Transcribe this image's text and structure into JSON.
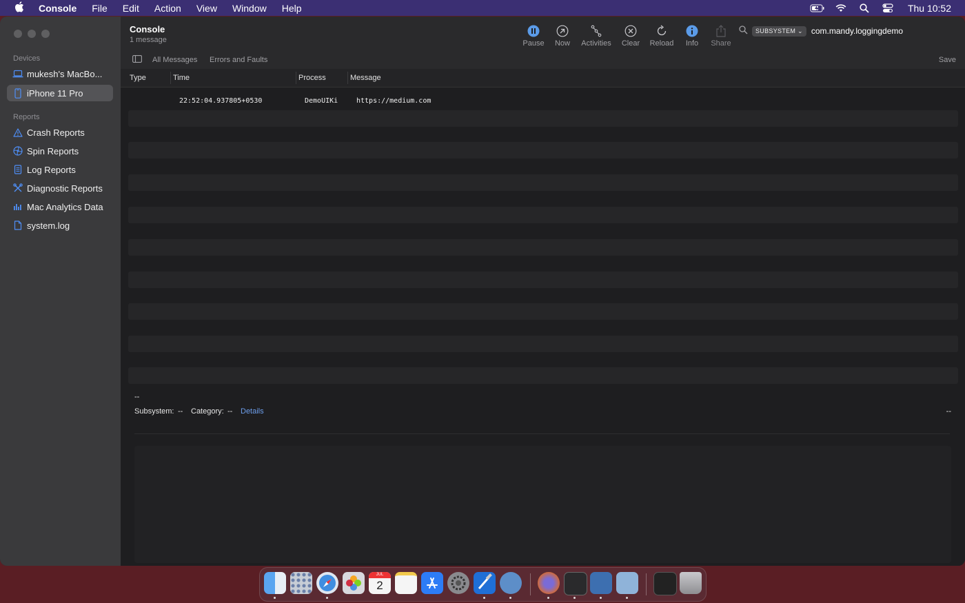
{
  "menubar": {
    "apple_icon": "apple-logo",
    "items": [
      "Console",
      "File",
      "Edit",
      "Action",
      "View",
      "Window",
      "Help"
    ],
    "status_icons": [
      "battery-icon",
      "wifi-icon",
      "search-icon",
      "control-center-icon"
    ],
    "clock": "Thu 10:52"
  },
  "window": {
    "title": "Console",
    "subtitle": "1 message"
  },
  "sidebar": {
    "devices_label": "Devices",
    "devices": [
      {
        "label": "mukesh's MacBo...",
        "icon": "laptop-icon",
        "selected": false
      },
      {
        "label": "iPhone 11 Pro",
        "icon": "iphone-icon",
        "selected": true
      }
    ],
    "reports_label": "Reports",
    "reports": [
      {
        "label": "Crash Reports",
        "icon": "warning-icon"
      },
      {
        "label": "Spin Reports",
        "icon": "spin-icon"
      },
      {
        "label": "Log Reports",
        "icon": "document-icon"
      },
      {
        "label": "Diagnostic Reports",
        "icon": "tools-icon"
      },
      {
        "label": "Mac Analytics Data",
        "icon": "chart-icon"
      },
      {
        "label": "system.log",
        "icon": "file-icon"
      }
    ]
  },
  "toolbar": {
    "buttons": [
      {
        "label": "Pause",
        "icon": "pause-icon"
      },
      {
        "label": "Now",
        "icon": "now-icon"
      },
      {
        "label": "Activities",
        "icon": "activities-icon"
      },
      {
        "label": "Clear",
        "icon": "clear-icon"
      },
      {
        "label": "Reload",
        "icon": "reload-icon"
      },
      {
        "label": "Info",
        "icon": "info-icon"
      },
      {
        "label": "Share",
        "icon": "share-icon"
      }
    ],
    "search": {
      "token": "SUBSYSTEM",
      "value": "com.mandy.loggingdemo"
    }
  },
  "filterbar": {
    "all_messages": "All Messages",
    "errors_and_faults": "Errors and Faults",
    "save": "Save"
  },
  "table": {
    "columns": [
      "Type",
      "Time",
      "Process",
      "Message"
    ],
    "rows": [
      {
        "type": "",
        "time": "22:52:04.937805+0530",
        "process": "DemoUIKi",
        "message": "https://medium.com"
      }
    ]
  },
  "detail": {
    "title": "--",
    "subsystem_label": "Subsystem:",
    "subsystem_value": "--",
    "category_label": "Category:",
    "category_value": "--",
    "details_link": "Details",
    "right_value": "--"
  },
  "dock": {
    "apps": [
      "finder-icon",
      "launchpad-icon",
      "safari-icon",
      "photos-icon",
      "calendar-icon",
      "notes-icon",
      "app-store-icon",
      "system-preferences-icon",
      "xcode-icon",
      "network-utility-icon",
      "firefox-icon",
      "console-icon",
      "proxyman-icon",
      "simulator-icon",
      "downloads-icon",
      "trash-icon"
    ],
    "calendar_month": "JUL",
    "calendar_day": "2"
  },
  "colors": {
    "menubar": "#3b2f73",
    "desktop": "#5a1e24",
    "sidebar": "#3a3a3c",
    "selection": "#545457",
    "link": "#6d9eeb",
    "toolbar_icon_active": "#5b9be8"
  }
}
